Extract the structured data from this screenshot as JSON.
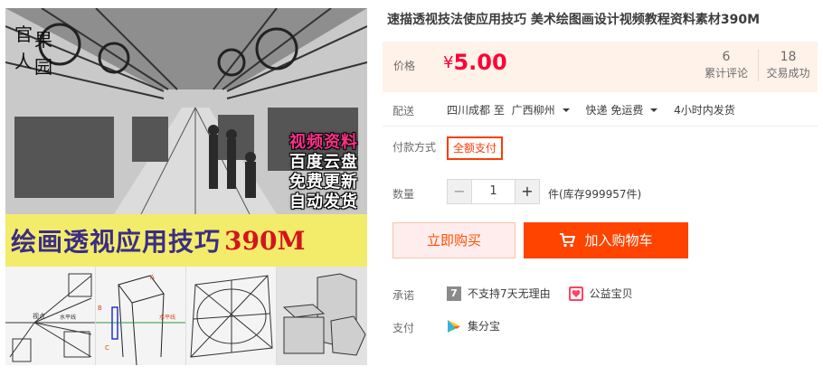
{
  "image": {
    "brand_logo_chars": [
      "官",
      "人",
      "果",
      "园"
    ],
    "promo_lines": [
      "视频资料",
      "百度云盘",
      "免费更新",
      "自动发货"
    ],
    "banner_text": "绘画透视应用技巧",
    "banner_number": "390M",
    "thumb_labels": [
      "视点",
      "水平线",
      "水平线",
      "A",
      "B",
      "C"
    ]
  },
  "product": {
    "title": "速描透视技法使应用技巧 美术绘图画设计视频教程资料素材390M"
  },
  "price": {
    "label": "价格",
    "currency": "¥",
    "value": "5.00",
    "reviews_count": "6",
    "reviews_label": "累计评论",
    "deals_count": "18",
    "deals_label": "交易成功"
  },
  "shipping": {
    "label": "配送",
    "from": "四川成都 至",
    "to": "广西柳州",
    "method": "快递 免运费",
    "dispatch": "4小时内发货"
  },
  "payment_method": {
    "label": "付款方式",
    "option": "全额支付"
  },
  "quantity": {
    "label": "数量",
    "minus": "−",
    "value": "1",
    "plus": "+",
    "stock": "件(库存999957件)"
  },
  "actions": {
    "buy_now": "立即购买",
    "add_to_cart": "加入购物车"
  },
  "promise": {
    "label": "承诺",
    "badge_7": "7",
    "no_return": "不支持7天无理由",
    "charity": "公益宝贝"
  },
  "pay": {
    "label": "支付",
    "method": "集分宝"
  },
  "colors": {
    "price_red": "#ff0036",
    "accent_orange": "#ff4400",
    "price_panel_bg": "#fff2e8"
  }
}
